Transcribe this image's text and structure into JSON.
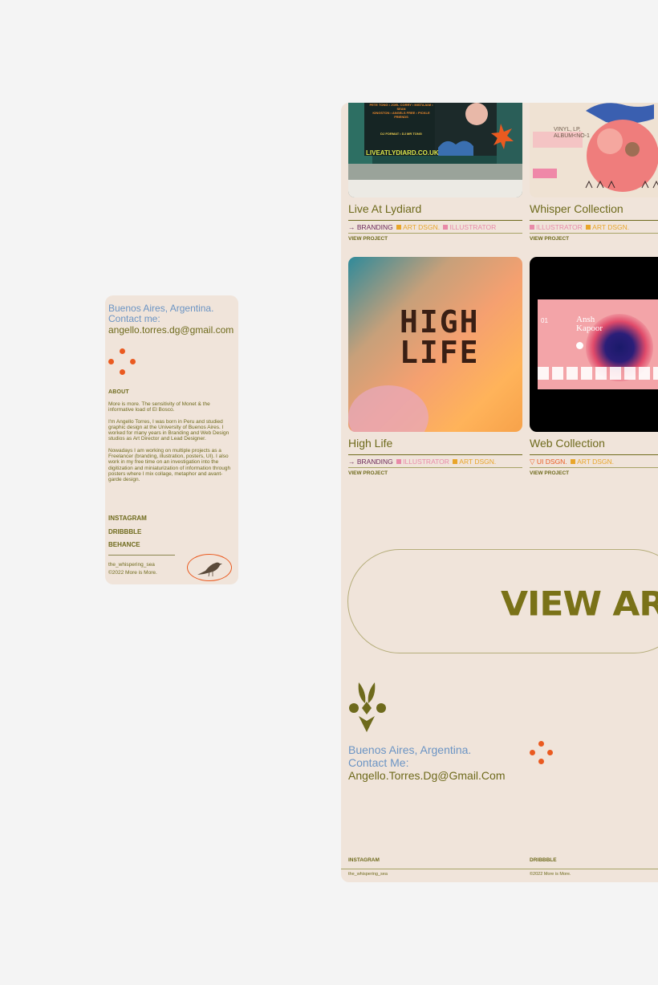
{
  "mobile": {
    "location": "Buenos Aires, Argentina.",
    "contact_label": "Contact me:",
    "email": "angello.torres.dg@gmail.com",
    "about_heading": "ABOUT",
    "about_paragraphs": [
      "More is more. The sensitivity of Monet & the informative load of El Bosco.",
      "I'm Angello Torres, I was born in Peru and studied graphic design at the University of Buenos Aires. I worked for many years in Branding and Web Design studios as Art Director and Lead Designer.",
      "Nowadays I am working on multiple projects as a Freelancer (branding, illustration, posters, UI). I also work in my free time on an investigation into the digitization and miniaturization of information through posters where I mix collage, metaphor and avant-garde design."
    ],
    "links": [
      "INSTAGRAM",
      "DRIBBBLE",
      "BEHANCE"
    ],
    "handle": "the_whispering_sea",
    "copyright": "©2022 More is More."
  },
  "desktop": {
    "projects": [
      {
        "title": "Live At Lydiard",
        "tags": [
          {
            "label": "→ BRANDING",
            "color": "#6d2a5c"
          },
          {
            "label": "ART DSGN.",
            "color": "#e8a52a",
            "square": true
          },
          {
            "label": "ILLUSTRATOR",
            "color": "#e88aa8",
            "square": true
          }
        ],
        "link": "VIEW PROJECT"
      },
      {
        "title": "Whisper Collection",
        "tags": [
          {
            "label": "ILLUSTRATOR",
            "color": "#e88aa8",
            "square": true
          },
          {
            "label": "ART DSGN.",
            "color": "#e8a52a",
            "square": true
          }
        ],
        "link": "VIEW PROJECT"
      },
      {
        "title": "High Life",
        "tags": [
          {
            "label": "→ BRANDING",
            "color": "#6d2a5c"
          },
          {
            "label": "ILLUSTRATOR",
            "color": "#e88aa8",
            "square": true
          },
          {
            "label": "ART DSGN.",
            "color": "#e8a52a",
            "square": true
          }
        ],
        "link": "VIEW PROJECT"
      },
      {
        "title": "Web Collection",
        "tags": [
          {
            "label": "▽ UI DSGN.",
            "color": "#ea5a20"
          },
          {
            "label": "ART DSGN.",
            "color": "#e8a52a",
            "square": true
          }
        ],
        "link": "VIEW PROJECT"
      }
    ],
    "poster_text": {
      "line1": "PETE TONG • JOEL CORRY • MISTAJAM • SEAN",
      "line2": "KINGSTON • ANGELS FREE • PICKLE FRIENDS",
      "dj": "DJ FORMAT • DJ MR TONG",
      "url": "LIVEATLYDIARD.CO.UK"
    },
    "vinyl_text": {
      "line1": "VINYL, LP,",
      "line2": "ALBUM<NO-1"
    },
    "web_text": {
      "line1": "Ansh",
      "line2": "Kapoor",
      "num": "01"
    },
    "highlife_text": {
      "line1": "HIGH",
      "line2": "LIFE"
    },
    "cta": "VIEW ARCHIVE",
    "location": "Buenos Aires, Argentina.",
    "contact_label": "Contact Me:",
    "email": "Angello.Torres.Dg@Gmail.Com",
    "instagram": "INSTAGRAM",
    "dribbble": "DRIBBBLE",
    "handle": "the_whispering_sea",
    "copyright": "©2022 More is More."
  },
  "colors": {
    "olive": "#6e6a1c",
    "blue": "#6b94c4",
    "orange": "#ea5a20",
    "card_bg": "#f0e4da",
    "page_bg": "#f4f4f4"
  }
}
